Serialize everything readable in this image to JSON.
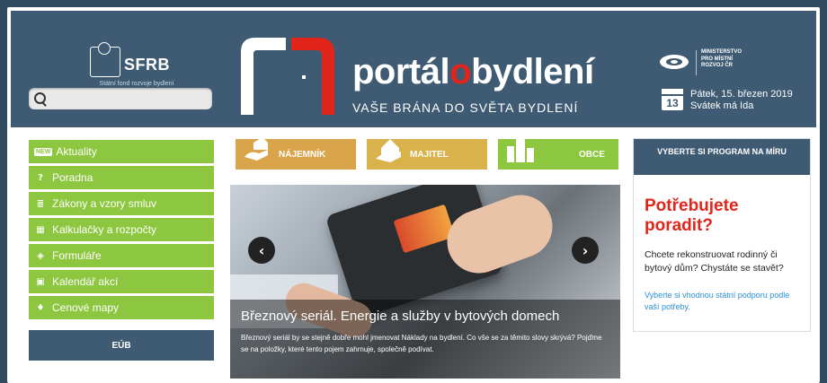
{
  "header": {
    "sfrb": {
      "name": "SFRB",
      "subtitle": "Státní fond rozvoje bydlení"
    },
    "search": {
      "value": "",
      "placeholder": ""
    },
    "brand": {
      "title_prefix": "portál",
      "title_highlight": "o",
      "title_suffix": "bydlení",
      "tagline": "VAŠE BRÁNA DO SVĚTA BYDLENÍ"
    },
    "ministry": {
      "line1": "MINISTERSTVO",
      "line2": "PRO MÍSTNÍ",
      "line3": "ROZVOJ ČR"
    },
    "calendar": {
      "day": "13",
      "date": "Pátek, 15. březen 2019",
      "nameday": "Svátek má Ida"
    }
  },
  "sidebar": {
    "items": [
      {
        "label": "Aktuality",
        "icon": "new-badge-icon",
        "badge": "NEW"
      },
      {
        "label": "Poradna",
        "icon": "question-icon"
      },
      {
        "label": "Zákony a vzory smluv",
        "icon": "document-icon"
      },
      {
        "label": "Kalkulačky a rozpočty",
        "icon": "calculator-icon"
      },
      {
        "label": "Formuláře",
        "icon": "layers-icon"
      },
      {
        "label": "Kalendář akcí",
        "icon": "calendar-icon"
      },
      {
        "label": "Cenové mapy",
        "icon": "map-pin-icon"
      }
    ],
    "eub": "EÚB"
  },
  "tiles": [
    {
      "label": "NÁJEMNÍK",
      "icon": "tenant-icon"
    },
    {
      "label": "MAJITEL",
      "icon": "owner-house-icon"
    },
    {
      "label": "OBCE",
      "icon": "municipality-icon"
    }
  ],
  "slider": {
    "title": "Březnový seriál. Energie a služby v bytových domech",
    "text": "Březnový seriál by se stejně dobře mohl jmenovat Náklady na bydlení. Co vše se za těmito slovy skrývá? Pojďme se na položky, které tento pojem zahrnuje, společně podívat."
  },
  "right_panel": {
    "heading": "VYBERTE SI PROGRAM NA MÍRU",
    "title": "Potřebujete poradit?",
    "text": "Chcete rekonstruovat rodinný či bytový dům? Chystáte se stavět?",
    "link": "Vyberte si vhodnou státní podporu podle vaší potřeby."
  },
  "colors": {
    "header": "#3e5b73",
    "nav_green": "#8dc63f",
    "accent_red": "#e1251b",
    "link_blue": "#2a8fd3"
  }
}
